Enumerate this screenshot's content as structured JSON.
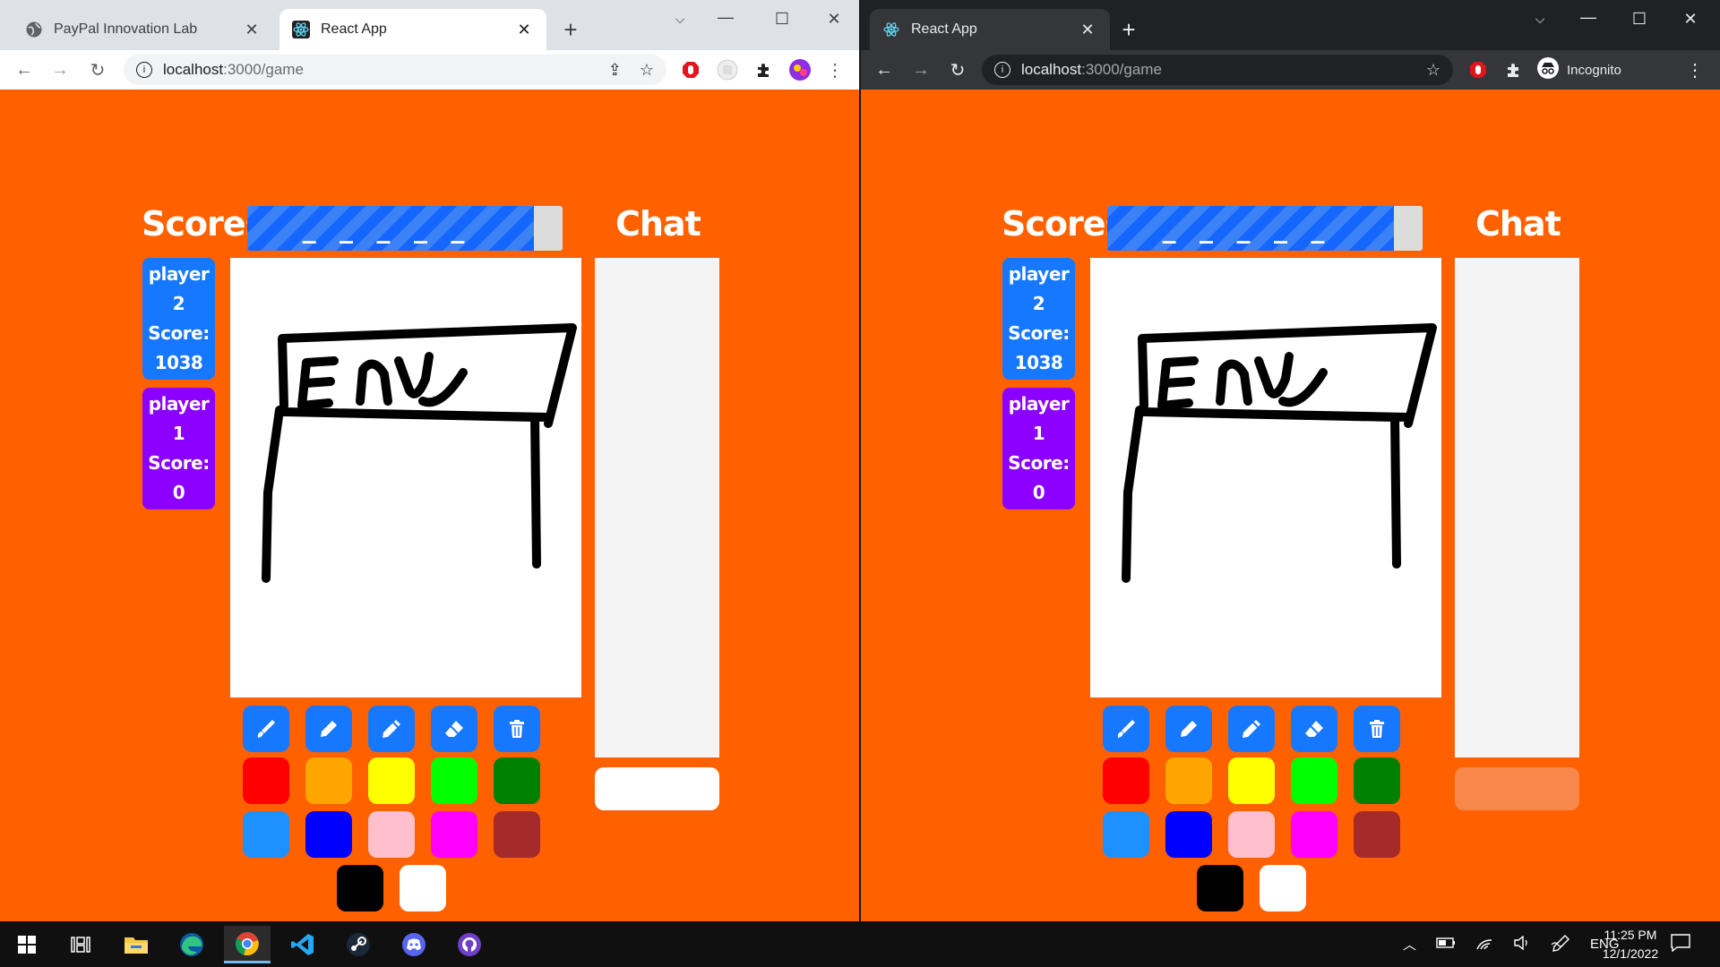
{
  "left_window": {
    "theme": "light",
    "tabs": [
      {
        "title": "PayPal Innovation Lab",
        "icon": "globe-icon",
        "active": false
      },
      {
        "title": "React App",
        "icon": "react-icon",
        "active": true
      }
    ],
    "url": {
      "host": "localhost",
      "path": ":3000/game"
    },
    "profile": "avatar"
  },
  "right_window": {
    "theme": "dark",
    "tabs": [
      {
        "title": "React App",
        "icon": "react-icon",
        "active": true
      }
    ],
    "url": {
      "host": "localhost",
      "path": ":3000/game"
    },
    "profile_label": "Incognito"
  },
  "game": {
    "scores_title": "Scores",
    "chat_title": "Chat",
    "hidden_word": "_ _ _ _ _",
    "timer_progress": 0.91,
    "players": [
      {
        "label": "player",
        "number": "2",
        "score_label": "Score:",
        "score": "1038",
        "color": "#1677ff"
      },
      {
        "label": "player",
        "number": "1",
        "score_label": "Score:",
        "score": "0",
        "color": "#8b00ff"
      }
    ],
    "tools": [
      "brush-icon",
      "pen-icon",
      "pencil-icon",
      "eraser-icon",
      "trash-icon"
    ],
    "colors": [
      "#ff0000",
      "#ffa500",
      "#ffff00",
      "#00ff00",
      "#008000",
      "#1e90ff",
      "#0000ff",
      "#ffc0cb",
      "#ff00ff",
      "#a52a2a",
      "#000000",
      "#ffffff"
    ],
    "left_chat_input_color": "#ffffff",
    "right_chat_input_color": "#f8874a"
  },
  "taskbar": {
    "apps": [
      "windows-start-icon",
      "task-view-icon",
      "file-explorer-icon",
      "edge-icon",
      "chrome-icon",
      "vscode-icon",
      "steam-icon",
      "discord-icon",
      "github-icon"
    ],
    "active_app": "chrome-icon",
    "language": "ENG",
    "time": "11:25 PM",
    "date": "12/1/2022"
  }
}
